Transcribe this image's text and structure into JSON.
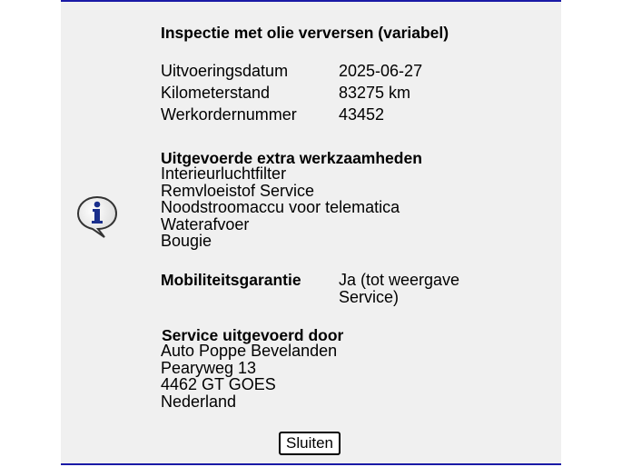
{
  "dialog": {
    "title": "Inspectie met olie verversen (variabel)",
    "icon": "info-icon",
    "details": [
      {
        "label": "Uitvoeringsdatum",
        "value": "2025-06-27"
      },
      {
        "label": "Kilometerstand",
        "value": "83275 km"
      },
      {
        "label": "Werkordernummer",
        "value": "43452"
      }
    ],
    "extra_work": {
      "heading": "Uitgevoerde extra werkzaamheden",
      "items": [
        "Interieurluchtfilter",
        "Remvloeistof Service",
        "Noodstroomaccu voor telematica",
        "Waterafvoer",
        "Bougie"
      ]
    },
    "mobility": {
      "label": "Mobiliteitsgarantie",
      "value": "Ja (tot weergave Service)"
    },
    "service": {
      "heading": "Service uitgevoerd door",
      "lines": [
        "Auto Poppe Bevelanden",
        "Pearyweg 13",
        "4462 GT GOES",
        "Nederland"
      ]
    },
    "close_label": "Sluiten"
  },
  "colors": {
    "panel_background": "#f0f0f0",
    "border": "#1a1aa6",
    "icon_blue": "#1a2f8c"
  }
}
